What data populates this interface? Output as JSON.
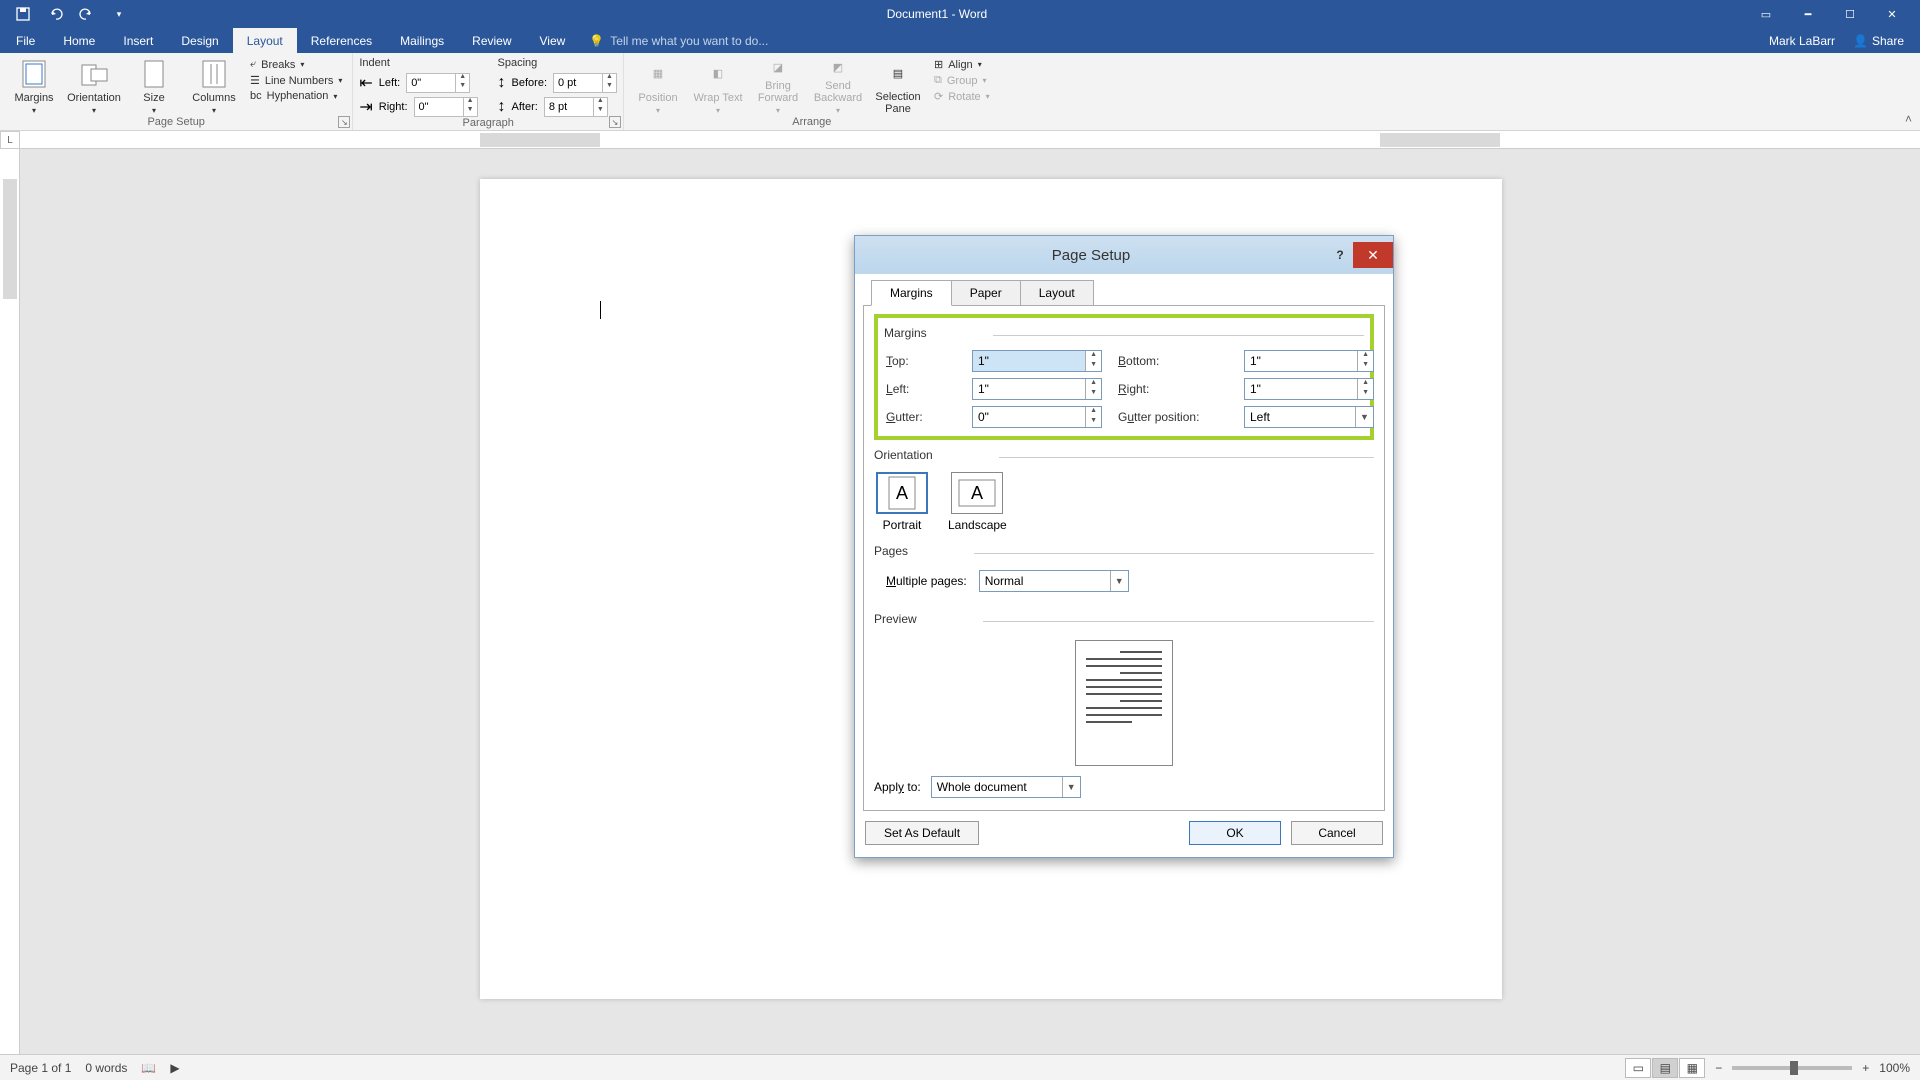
{
  "titlebar": {
    "document": "Document1 - Word"
  },
  "user": {
    "name": "Mark LaBarr",
    "share": "Share"
  },
  "tabs": {
    "file": "File",
    "home": "Home",
    "insert": "Insert",
    "design": "Design",
    "layout": "Layout",
    "references": "References",
    "mailings": "Mailings",
    "review": "Review",
    "view": "View"
  },
  "tellme": {
    "placeholder": "Tell me what you want to do..."
  },
  "ribbon": {
    "pagesetup": {
      "label": "Page Setup",
      "margins": "Margins",
      "orientation": "Orientation",
      "size": "Size",
      "columns": "Columns",
      "breaks": "Breaks",
      "linenumbers": "Line Numbers",
      "hyphenation": "Hyphenation"
    },
    "paragraph": {
      "label": "Paragraph",
      "indent": "Indent",
      "left": "Left:",
      "right": "Right:",
      "leftv": "0\"",
      "rightv": "0\"",
      "spacing": "Spacing",
      "before": "Before:",
      "after": "After:",
      "beforev": "0 pt",
      "afterv": "8 pt"
    },
    "arrange": {
      "label": "Arrange",
      "position": "Position",
      "wrap": "Wrap Text",
      "forward": "Bring Forward",
      "backward": "Send Backward",
      "selpane": "Selection Pane",
      "align": "Align",
      "group": "Group",
      "rotate": "Rotate"
    }
  },
  "status": {
    "page": "Page 1 of 1",
    "words": "0 words",
    "zoom": "100%"
  },
  "dialog": {
    "title": "Page Setup",
    "tabs": {
      "margins": "Margins",
      "paper": "Paper",
      "layout": "Layout"
    },
    "margins": {
      "label": "Margins",
      "top": "Top:",
      "bottom": "Bottom:",
      "left": "Left:",
      "right": "Right:",
      "gutter": "Gutter:",
      "gutterpos": "Gutter position:",
      "topv": "1\"",
      "bottomv": "1\"",
      "leftv": "1\"",
      "rightv": "1\"",
      "gutterv": "0\"",
      "gutterposv": "Left"
    },
    "orientation": {
      "label": "Orientation",
      "portrait": "Portrait",
      "landscape": "Landscape"
    },
    "pages": {
      "label": "Pages",
      "multi": "Multiple pages:",
      "multiv": "Normal"
    },
    "preview": "Preview",
    "apply": {
      "label": "Apply to:",
      "value": "Whole document"
    },
    "buttons": {
      "setdefault": "Set As Default",
      "ok": "OK",
      "cancel": "Cancel"
    }
  }
}
